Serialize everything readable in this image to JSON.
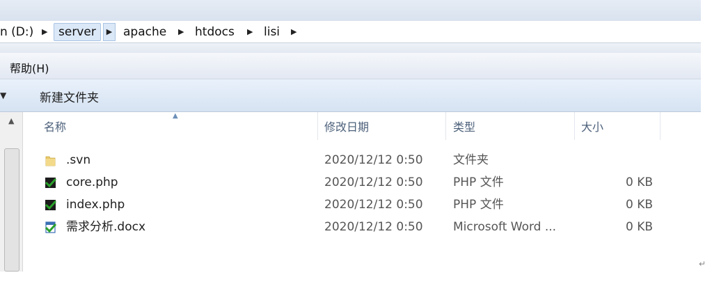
{
  "address": {
    "drive": "n (D:)",
    "crumbs": [
      "server",
      "apache",
      "htdocs",
      "lisi"
    ]
  },
  "menu": {
    "help": "帮助(H)"
  },
  "toolbar": {
    "new_folder": "新建文件夹"
  },
  "columns": {
    "name": "名称",
    "date": "修改日期",
    "type": "类型",
    "size": "大小"
  },
  "files": [
    {
      "name": ".svn",
      "date": "2020/12/12 0:50",
      "type": "文件夹",
      "size": "",
      "icon": "folder-icon"
    },
    {
      "name": "core.php",
      "date": "2020/12/12 0:50",
      "type": "PHP 文件",
      "size": "0 KB",
      "icon": "svn-php-file-icon"
    },
    {
      "name": "index.php",
      "date": "2020/12/12 0:50",
      "type": "PHP 文件",
      "size": "0 KB",
      "icon": "svn-php-file-icon"
    },
    {
      "name": "需求分析.docx",
      "date": "2020/12/12 0:50",
      "type": "Microsoft Word ...",
      "size": "0 KB",
      "icon": "svn-docx-file-icon"
    }
  ],
  "colors": {
    "accent": "#dbe8f7",
    "svn_check": "#2aa12a",
    "header_text": "#4c607a"
  },
  "misc": {
    "return_mark": "↵"
  }
}
